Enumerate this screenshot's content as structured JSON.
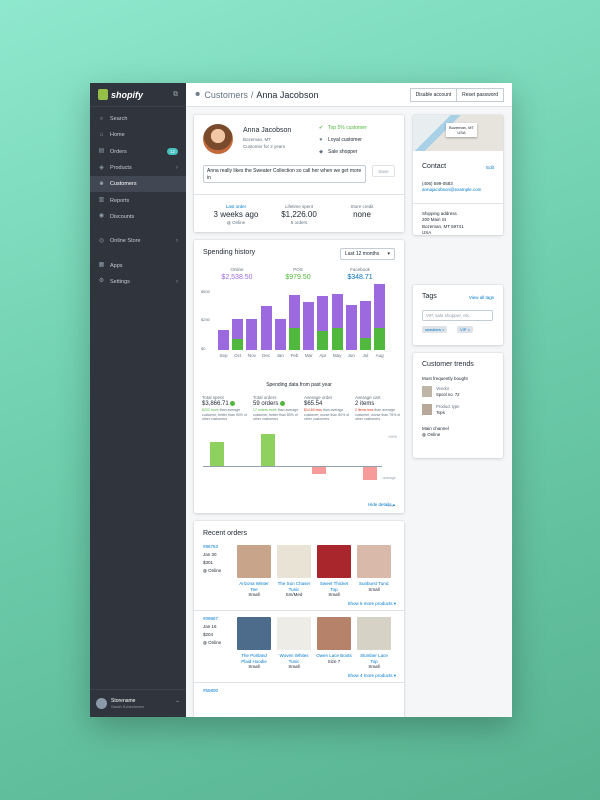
{
  "brand": "shopify",
  "nav": [
    {
      "icon": "search-icon",
      "glyph": "⌕",
      "label": "Search"
    },
    {
      "icon": "home-icon",
      "glyph": "⌂",
      "label": "Home"
    },
    {
      "icon": "orders-icon",
      "glyph": "▤",
      "label": "Orders",
      "badge": "12"
    },
    {
      "icon": "products-icon",
      "glyph": "◈",
      "label": "Products",
      "chev": "›"
    },
    {
      "icon": "customers-icon",
      "glyph": "☻",
      "label": "Customers",
      "active": true
    },
    {
      "icon": "reports-icon",
      "glyph": "▥",
      "label": "Reports"
    },
    {
      "icon": "discounts-icon",
      "glyph": "◉",
      "label": "Discounts"
    },
    {
      "icon": "online-store-icon",
      "glyph": "◎",
      "label": "Online Store",
      "chev": "›"
    },
    {
      "icon": "apps-icon",
      "glyph": "▦",
      "label": "Apps"
    },
    {
      "icon": "settings-icon",
      "glyph": "⚙",
      "label": "Settings",
      "chev": "›"
    }
  ],
  "footer": {
    "store": "Storename",
    "user": "Sarah Schechmen"
  },
  "header": {
    "section": "Customers",
    "name": "Anna Jacobson",
    "disable": "Disable account",
    "reset": "Reset password"
  },
  "customer": {
    "name": "Anna Jacobson",
    "location": "Bozeman, MT",
    "tenure": "Customer for 2 years",
    "tags": [
      {
        "icon": "check-circle-icon",
        "label": "Top 5% customer"
      },
      {
        "icon": "heart-icon",
        "label": "Loyal customer"
      },
      {
        "icon": "tag-icon",
        "label": "Sale shopper"
      }
    ],
    "note": "Anna really likes the Sweater Collection so call her when we get more in",
    "save": "Save",
    "stats": [
      {
        "label": "Last order",
        "value": "3 weeks ago",
        "sub": "Online"
      },
      {
        "label": "Lifetime spent",
        "value": "$1,226.00",
        "sub": "6 orders"
      },
      {
        "label": "Store credit",
        "value": "none",
        "sub": ""
      }
    ]
  },
  "spending": {
    "title": "Spending history",
    "range": "Last 12 months",
    "channels": [
      {
        "label": "Online",
        "value": "$2,538.50",
        "color": "#9c6ade"
      },
      {
        "label": "POS",
        "value": "$979.50",
        "color": "#50b83c"
      },
      {
        "label": "Facebook",
        "value": "$348.71",
        "color": "#006fbb"
      }
    ],
    "yticks": [
      "$500",
      "$250",
      "$0"
    ],
    "breakdown_title": "Spending data from past year",
    "metrics": [
      {
        "label": "Total spent",
        "value": "$3,866.71",
        "ok": true,
        "pre": "",
        "hl": "$202 more",
        "post": " than average customer, better than 90% of other customers",
        "red": false
      },
      {
        "label": "Total orders",
        "value": "59 orders",
        "ok": true,
        "pre": "",
        "hl": "17 orders more",
        "post": " than average customer, better than 80% of other customers",
        "red": false
      },
      {
        "label": "Average order",
        "value": "$65.54",
        "ok": false,
        "pre": "",
        "hl": "$14.60 less",
        "post": " than average customer, worse than 60% of other customers",
        "red": true
      },
      {
        "label": "Average cart",
        "value": "2 items",
        "ok": false,
        "pre": "",
        "hl": "2 items less",
        "post": " than average customer, worse than 75% of other customers",
        "red": true
      }
    ],
    "diff_labels": {
      "top": "100%",
      "mid": "average",
      "bottom": "0%"
    },
    "hide": "Hide details ▴"
  },
  "chart_data": {
    "type": "bar",
    "categories": [
      "Sep",
      "Oct",
      "Nov",
      "Dec",
      "Jan",
      "Feb",
      "Mar",
      "Apr",
      "May",
      "Jun",
      "Jul",
      "Aug"
    ],
    "series": [
      {
        "name": "POS",
        "color": "#50b83c",
        "values": [
          0,
          100,
          0,
          0,
          0,
          200,
          0,
          170,
          200,
          0,
          110,
          200
        ]
      },
      {
        "name": "Online",
        "color": "#9c6ade",
        "values": [
          180,
          180,
          280,
          400,
          280,
          300,
          440,
          320,
          310,
          410,
          340,
          400
        ]
      }
    ],
    "ylim": [
      0,
      500
    ],
    "deviation": [
      {
        "category": "Total spent",
        "value": 0.6
      },
      {
        "category": "Total orders",
        "value": 0.8
      },
      {
        "category": "Average order",
        "value": -0.2
      },
      {
        "category": "Average cart",
        "value": -0.35
      }
    ]
  },
  "recent": {
    "title": "Recent orders",
    "orders": [
      {
        "id": "#86753",
        "date": "Jan 30",
        "total": "$301",
        "channel": "Online",
        "more": "Show 6 more products ▾",
        "products": [
          {
            "name": "Arizona Winter Tee",
            "size": "Small",
            "color": "#c8a58a"
          },
          {
            "name": "The Sun Chaser Tunic",
            "size": "Sm/Med",
            "color": "#e9e3d6"
          },
          {
            "name": "Sweet Thicket Top",
            "size": "Small",
            "color": "#a9262d"
          },
          {
            "name": "Sunburst Tunic",
            "size": "Small",
            "color": "#d9b9aa"
          }
        ]
      },
      {
        "id": "#09867",
        "date": "Jan 16",
        "total": "$204",
        "channel": "Online",
        "more": "Show 4 more products ▾",
        "products": [
          {
            "name": "The Portland Plaid Hoodie",
            "size": "Small",
            "color": "#4d6b8a"
          },
          {
            "name": "Woven Whites Tunic",
            "size": "Small",
            "color": "#eeece6"
          },
          {
            "name": "Owen Lace Boots",
            "size": "Size 7",
            "color": "#b6836a"
          },
          {
            "name": "Slumber Lace Top",
            "size": "Small",
            "color": "#d6d2c6"
          }
        ]
      },
      {
        "id": "#55800"
      }
    ]
  },
  "map_label": {
    "line1": "Bozeman, MT",
    "line2": "USA"
  },
  "contact": {
    "title": "Contact",
    "edit": "Edit",
    "phone": "(406) 599-0583",
    "email": "annajacobson@example.com",
    "ship_label": "Shipping address",
    "ship": [
      "200 Main St",
      "Bozeman, MT 59741",
      "USA"
    ],
    "bill_label": "Billing address",
    "bill": [
      "200 Main St",
      "Bozeman, MT 59741",
      "USA"
    ]
  },
  "tags": {
    "title": "Tags",
    "viewall": "View all tags",
    "placeholder": "VIP, sale shopper, etc.",
    "chips": [
      "sweaters ×",
      "VIP ×"
    ]
  },
  "trends": {
    "title": "Customer trends",
    "most": "Most frequently bought",
    "items": [
      {
        "k": "Vendor",
        "v": "Spool no. 72",
        "color": "#c0b6a8"
      },
      {
        "k": "Product type",
        "v": "Tops",
        "color": "#b8a89a"
      }
    ],
    "main_label": "Main channel",
    "main": "Online"
  }
}
